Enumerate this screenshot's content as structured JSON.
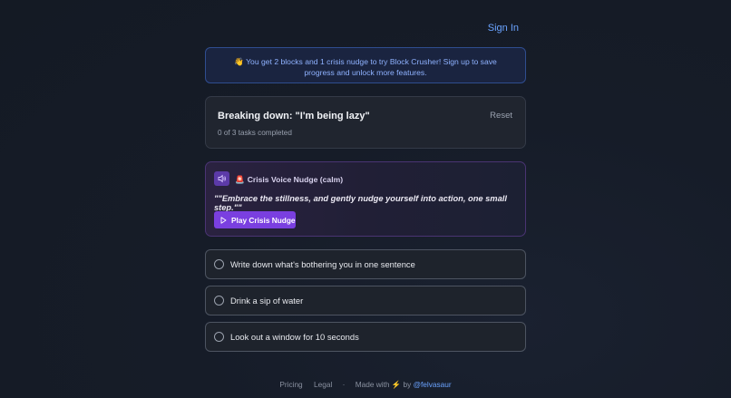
{
  "header": {
    "top_partial_text": "...",
    "sign_in": "Sign In"
  },
  "banner": {
    "emoji": "👋",
    "text": "You get 2 blocks and 1 crisis nudge to try Block Crusher! Sign up to save progress and unlock more features."
  },
  "breakdown": {
    "title": "Breaking down: \"I'm being lazy\"",
    "progress": "0 of 3 tasks completed",
    "reset_label": "Reset"
  },
  "crisis": {
    "speaker_icon": "speaker-icon",
    "siren_icon": "🚨",
    "heading": "Crisis Voice Nudge (calm)",
    "quote": "\"\"Embrace the stillness, and gently nudge yourself into action, one small step.\"\"",
    "play_label": "Play Crisis Nudge",
    "accent": "#7a3fe0"
  },
  "tasks": [
    {
      "label": "Write down what's bothering you in one sentence",
      "completed": false
    },
    {
      "label": "Drink a sip of water",
      "completed": false
    },
    {
      "label": "Look out a window for 10 seconds",
      "completed": false
    }
  ],
  "footer": {
    "pricing": "Pricing",
    "legal": "Legal",
    "separator": "·",
    "made_with": "Made with",
    "bolt": "⚡",
    "by": "by",
    "handle": "@felvasaur"
  }
}
